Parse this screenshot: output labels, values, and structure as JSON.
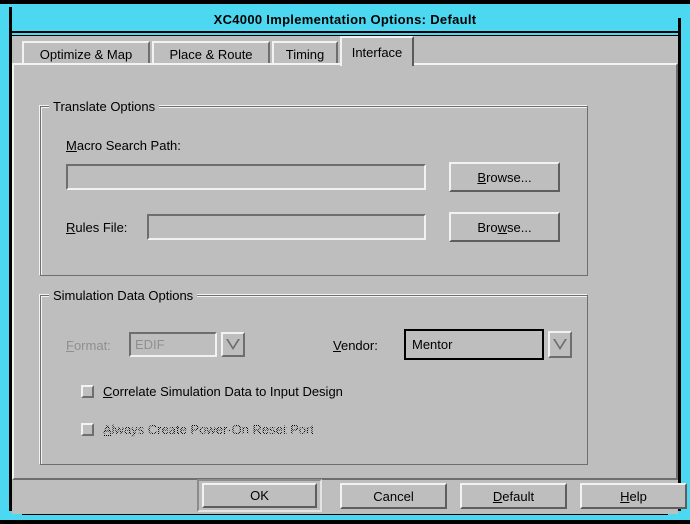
{
  "window": {
    "title": "XC4000 Implementation Options: Default",
    "frame_color": "#4bd8f0",
    "face_color": "#bebebe"
  },
  "tabs": [
    {
      "label": "Optimize & Map",
      "active": false
    },
    {
      "label": "Place & Route",
      "active": false
    },
    {
      "label": "Timing",
      "active": false
    },
    {
      "label": "Interface",
      "active": true
    }
  ],
  "translate_options": {
    "group_title": "Translate Options",
    "macro_search_path": {
      "label_pre": "",
      "label_mn": "M",
      "label_post": "acro Search Path:",
      "value": "",
      "browse": {
        "pre": "",
        "mn": "B",
        "post": "rowse..."
      }
    },
    "rules_file": {
      "label_pre": "",
      "label_mn": "R",
      "label_post": "ules File:",
      "value": "",
      "browse": {
        "pre": "Bro",
        "mn": "w",
        "post": "se..."
      }
    }
  },
  "simulation_data_options": {
    "group_title": "Simulation Data Options",
    "format": {
      "label_pre": "",
      "label_mn": "F",
      "label_post": "ormat:",
      "value": "EDIF",
      "enabled": false,
      "options": [
        "EDIF"
      ]
    },
    "vendor": {
      "label_pre": "",
      "label_mn": "V",
      "label_post": "endor:",
      "value": "Mentor",
      "enabled": true,
      "focused": true,
      "options": [
        "Mentor"
      ]
    },
    "correlate_checkbox": {
      "pre": "",
      "mn": "C",
      "post": "orrelate Simulation Data to Input Design",
      "checked": false,
      "enabled": true
    },
    "power_on_reset_checkbox": {
      "pre": "",
      "mn": "A",
      "post": "lways Create Power-On Reset Port",
      "checked": false,
      "enabled": false
    }
  },
  "buttons": {
    "ok": {
      "pre": "OK",
      "mn": "",
      "post": "",
      "default": true
    },
    "cancel": {
      "pre": "Cancel",
      "mn": "",
      "post": "",
      "default": false
    },
    "default": {
      "pre": "",
      "mn": "D",
      "post": "efault",
      "default": false
    },
    "help": {
      "pre": "",
      "mn": "H",
      "post": "elp",
      "default": false
    }
  }
}
